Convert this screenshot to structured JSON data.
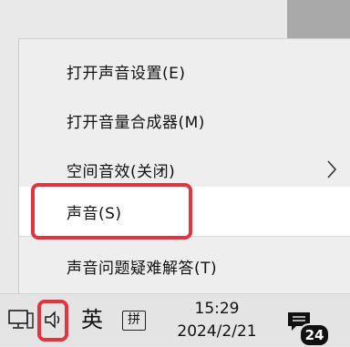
{
  "context_menu": {
    "items": [
      {
        "label": "打开声音设置(E)"
      },
      {
        "label": "打开音量合成器(M)"
      },
      {
        "label": "空间音效(关闭)",
        "has_submenu": true
      },
      {
        "label": "声音(S)",
        "highlighted": true
      },
      {
        "label": "声音问题疑难解答(T)"
      }
    ]
  },
  "taskbar": {
    "ime_language": "英",
    "ime_mode": "拼",
    "clock_time": "15:29",
    "clock_date": "2024/2/21",
    "notification_count": "24"
  },
  "icons": {
    "network": "network-icon",
    "volume": "volume-icon",
    "submenu_arrow": "chevron-right-icon",
    "notifications": "notification-icon"
  },
  "colors": {
    "annotation": "#e2333f",
    "menu_background": "#eeeeee",
    "hover_background": "#ffffff"
  }
}
